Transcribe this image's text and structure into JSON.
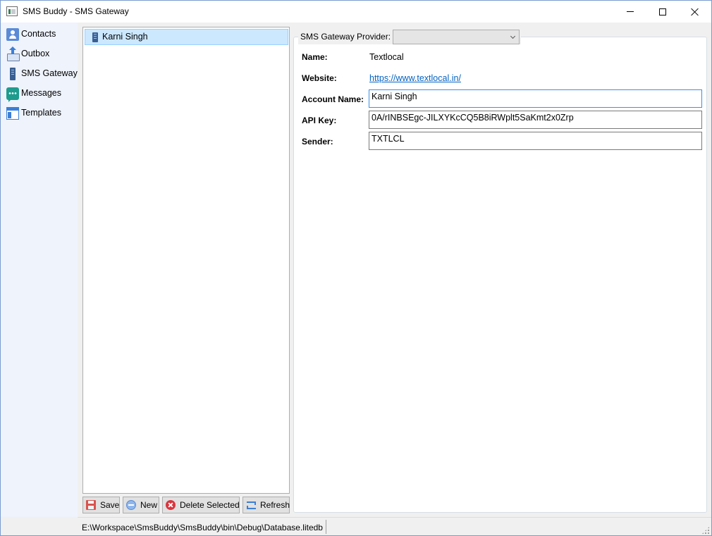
{
  "window": {
    "title": "SMS Buddy - SMS Gateway"
  },
  "sidebar": {
    "items": [
      {
        "label": "Contacts",
        "icon": "contacts-icon"
      },
      {
        "label": "Outbox",
        "icon": "outbox-icon"
      },
      {
        "label": "SMS Gateway",
        "icon": "sms-gateway-icon"
      },
      {
        "label": "Messages",
        "icon": "messages-icon"
      },
      {
        "label": "Templates",
        "icon": "templates-icon"
      }
    ]
  },
  "gateway_list": {
    "items": [
      {
        "label": "Karni Singh",
        "selected": true,
        "icon": "phone-icon"
      }
    ]
  },
  "toolbar": {
    "save_label": "Save",
    "new_label": "New",
    "delete_label": "Delete Selected",
    "refresh_label": "Refresh"
  },
  "details": {
    "provider_label": "SMS Gateway Provider:",
    "provider_value": "",
    "name_label": "Name:",
    "name_value": "Textlocal",
    "website_label": "Website:",
    "website_value": "https://www.textlocal.in/",
    "account_label": "Account Name:",
    "account_value": "Karni Singh",
    "apikey_label": "API Key:",
    "apikey_value": "0A/rINBSEgc-JILXYKcCQ5B8iRWplt5SaKmt2x0Zrp",
    "sender_label": "Sender:",
    "sender_value": "TXTLCL"
  },
  "statusbar": {
    "path": "E:\\Workspace\\SmsBuddy\\SmsBuddy\\bin\\Debug\\Database.litedb"
  },
  "colors": {
    "selection_bg": "#cce8ff",
    "link": "#0563c1",
    "sidebar_bg": "#eef3fc",
    "focus_border": "#3c8fe6"
  }
}
